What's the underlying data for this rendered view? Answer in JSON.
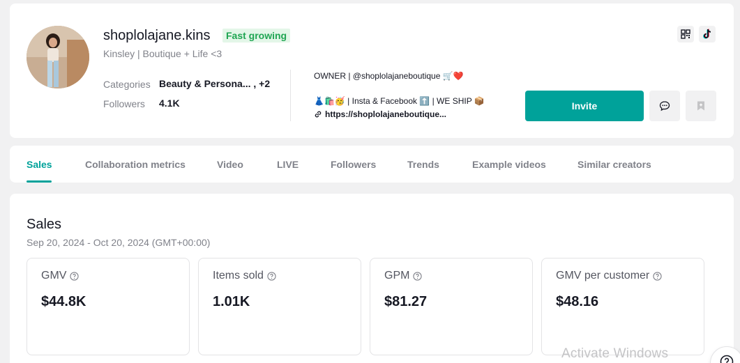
{
  "profile": {
    "username": "shoplolajane.kins",
    "badge": "Fast growing",
    "subtitle": "Kinsley | Boutique + Life <3",
    "categories_label": "Categories",
    "categories_value": "Beauty & Persona... , +2",
    "followers_label": "Followers",
    "followers_value": "4.1K",
    "bio_line1": "OWNER | @shoplolajaneboutique 🛒❤️",
    "bio_line2": "👗🛍️🥳 | Insta & Facebook ⬆️ | WE SHIP 📦",
    "bio_link": "https://shoplolajaneboutique...",
    "invite_label": "Invite"
  },
  "icons": {
    "qr": "qr-code-icon",
    "tiktok": "tiktok-icon",
    "message": "message-icon",
    "bookmark": "bookmark-icon",
    "link": "link-icon",
    "help": "help-icon"
  },
  "tabs": [
    {
      "label": "Sales",
      "active": true
    },
    {
      "label": "Collaboration metrics"
    },
    {
      "label": "Video"
    },
    {
      "label": "LIVE"
    },
    {
      "label": "Followers"
    },
    {
      "label": "Trends"
    },
    {
      "label": "Example videos"
    },
    {
      "label": "Similar creators"
    }
  ],
  "sales": {
    "title": "Sales",
    "range": "Sep 20, 2024 - Oct 20, 2024 (GMT+00:00)",
    "metrics": [
      {
        "label": "GMV",
        "value": "$44.8K"
      },
      {
        "label": "Items sold",
        "value": "1.01K"
      },
      {
        "label": "GPM",
        "value": "$81.27"
      },
      {
        "label": "GMV per customer",
        "value": "$48.16"
      }
    ]
  },
  "watermark": "Activate Windows",
  "colors": {
    "accent": "#00a29a",
    "badge_bg": "#e3f6e8",
    "badge_text": "#1fa552",
    "muted": "#80828a"
  }
}
